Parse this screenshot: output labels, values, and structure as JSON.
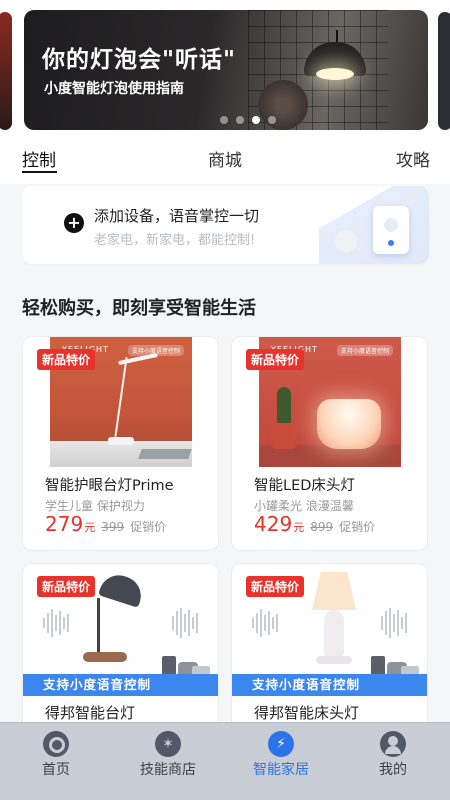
{
  "banner": {
    "title": "你的灯泡会\"听话\"",
    "subtitle": "小度智能灯泡使用指南",
    "dots": 4,
    "active_dot": 2
  },
  "tabs": [
    {
      "label": "控制",
      "active": true
    },
    {
      "label": "商城",
      "active": false
    },
    {
      "label": "攻略",
      "active": false
    }
  ],
  "add_device": {
    "title": "添加设备，语音掌控一切",
    "subtitle": "老家电，新家电，都能控制!"
  },
  "section_title": "轻松购买，即刻享受智能生活",
  "products": [
    {
      "tag": "新品特价",
      "brand": "YEELIGHT",
      "badge": "支持小度语音控制",
      "name": "智能护眼台灯Prime",
      "desc": "学生儿童 保护视力",
      "price": "279",
      "unit": "元",
      "old_price": "399",
      "promo": "促销价"
    },
    {
      "tag": "新品特价",
      "brand": "YEELIGHT",
      "badge": "支持小度语音控制",
      "name": "智能LED床头灯",
      "desc": "小罐柔光 浪漫温馨",
      "price": "429",
      "unit": "元",
      "old_price": "899",
      "promo": "促销价"
    },
    {
      "tag": "新品特价",
      "voice_banner": "支持小度语音控制",
      "name": "得邦智能台灯"
    },
    {
      "tag": "新品特价",
      "voice_banner": "支持小度语音控制",
      "name": "得邦智能床头灯"
    }
  ],
  "bottom_nav": [
    {
      "label": "首页",
      "icon": "home-icon",
      "active": false
    },
    {
      "label": "技能商店",
      "icon": "skill-store-icon",
      "active": false
    },
    {
      "label": "智能家居",
      "icon": "smart-home-plug-icon",
      "active": true
    },
    {
      "label": "我的",
      "icon": "profile-icon",
      "active": false
    }
  ],
  "colors": {
    "accent_blue": "#2a73e8",
    "sale_red": "#e8322c",
    "voice_blue": "#3b87ee"
  }
}
